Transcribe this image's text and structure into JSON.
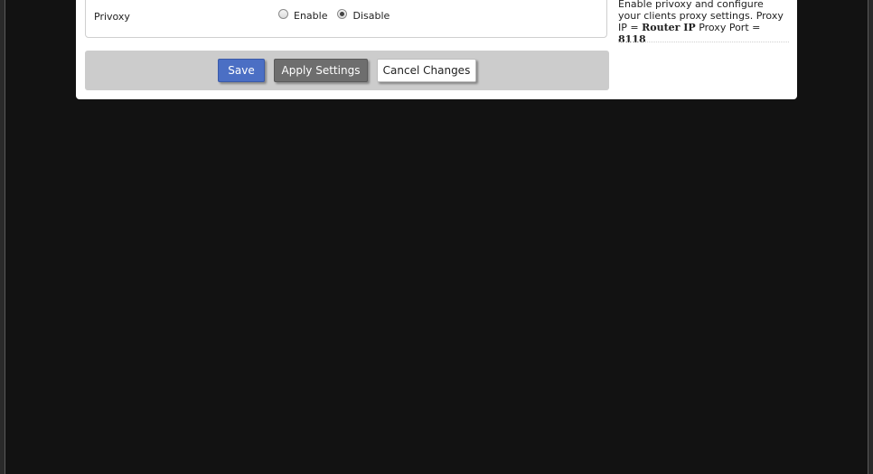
{
  "privoxy": {
    "label": "Privoxy",
    "options": [
      {
        "label": "Enable",
        "checked": false
      },
      {
        "label": "Disable",
        "checked": true
      }
    ]
  },
  "buttons": {
    "save": "Save",
    "apply": "Apply Settings",
    "cancel": "Cancel Changes"
  },
  "help": {
    "text1": "Enable privoxy and configure your clients proxy settings. Proxy IP = ",
    "router_ip": "Router IP",
    "text2": " Proxy Port = ",
    "port": "8118"
  },
  "colors": {
    "background": "#121212",
    "save": "#4b6fc4",
    "apply": "#6e6e6e"
  }
}
